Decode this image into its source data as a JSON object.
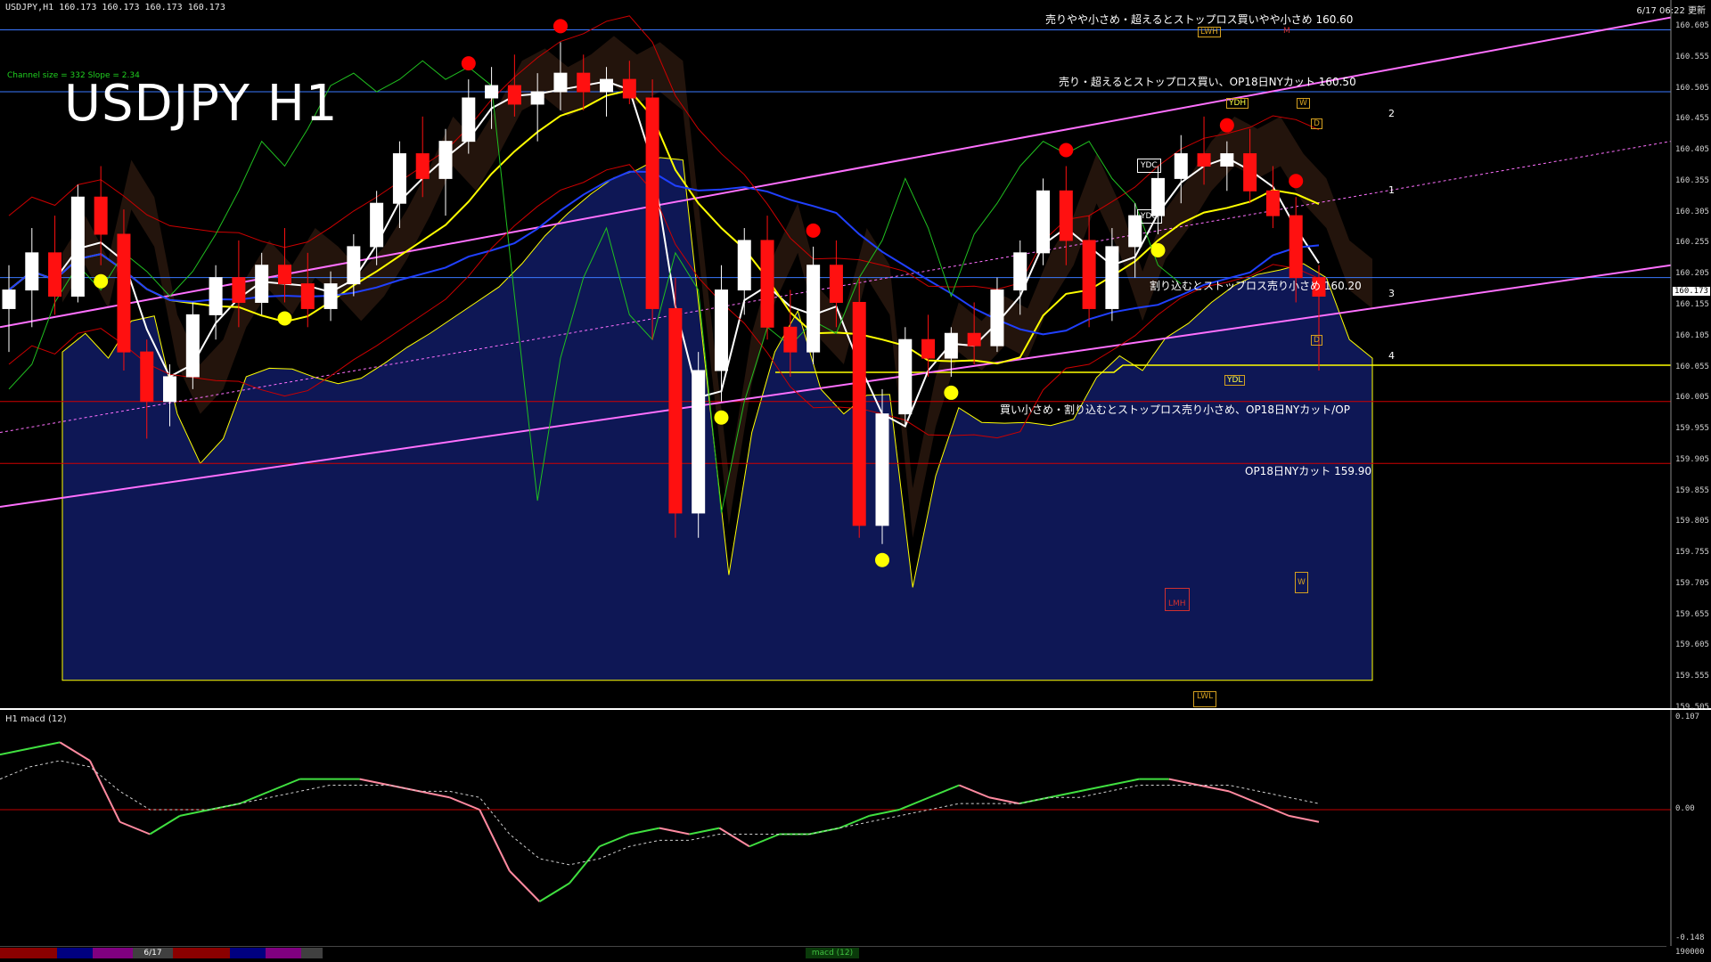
{
  "header": {
    "symbol_line": "USDJPY,H1  160.173 160.173 160.173 160.173",
    "title": "USDJPY H1",
    "channel_info": "Channel size = 332 Slope = 2.34",
    "clock": "6/17 06:22 更新"
  },
  "annotations": [
    {
      "text": "売りやや小さめ・超えるとストップロス買いやや小さめ 160.60"
    },
    {
      "text": "売り・超えるとストップロス買い、OP18日NYカット 160.50"
    },
    {
      "text": "割り込むとストップロス売り小さめ 160.20"
    },
    {
      "text": "買い小さめ・割り込むとストップロス売り小さめ、OP18日NYカット/OP"
    },
    {
      "text": "OP18日NYカット 159.90"
    }
  ],
  "level_tags": [
    "LWH",
    "M",
    "YDH",
    "W",
    "D",
    "YDC",
    "YDO",
    "YDL",
    "D",
    "W",
    "LMH",
    "LWL"
  ],
  "fib_levels": [
    "1",
    "2",
    "3",
    "4"
  ],
  "price_axis": {
    "labels": [
      "160.605",
      "160.555",
      "160.505",
      "160.455",
      "160.405",
      "160.355",
      "160.305",
      "160.255",
      "160.205",
      "160.155",
      "160.105",
      "160.055",
      "160.005",
      "159.955",
      "159.905",
      "159.855",
      "159.805",
      "159.755",
      "159.705",
      "159.655",
      "159.605",
      "159.555",
      "159.505"
    ],
    "current_price": "160.173"
  },
  "macd": {
    "label": "H1  macd (12)",
    "axis_top": "0.107",
    "axis_zero": "0.00",
    "axis_bottom": "-0.148",
    "axis_volume": "190000"
  },
  "bottom_tabs": {
    "date_tab": "6/17",
    "macd_tab": "macd (12)"
  },
  "colors": {
    "bull_candle": "#ffffff",
    "bear_candle": "#ff1010",
    "ma_short": "#ffffff",
    "ma_mid": "#ffff00",
    "ma_long": "#2040ff",
    "channel": "#ff70ff",
    "bollinger": "#cc0000",
    "chikou": "#20c020",
    "cloud_bull": "#1a2a9a",
    "cloud_bear": "#c07040",
    "support": "#ffff00",
    "macd_up": "#40e040",
    "macd_down": "#ff8aa0"
  },
  "chart_data": {
    "type": "candlestick",
    "title": "USDJPY H1",
    "timeframe": "H1",
    "date_marker": "6/17",
    "y_range": [
      159.505,
      160.605
    ],
    "horizontal_levels": [
      160.6,
      160.5,
      160.2,
      160.0,
      159.9
    ],
    "candles": [
      [
        160.15,
        160.22,
        160.08,
        160.18
      ],
      [
        160.18,
        160.28,
        160.12,
        160.24
      ],
      [
        160.24,
        160.3,
        160.14,
        160.17
      ],
      [
        160.17,
        160.35,
        160.16,
        160.33
      ],
      [
        160.33,
        160.38,
        160.22,
        160.27
      ],
      [
        160.27,
        160.31,
        160.05,
        160.08
      ],
      [
        160.08,
        160.1,
        159.94,
        160.0
      ],
      [
        160.0,
        160.06,
        159.96,
        160.04
      ],
      [
        160.04,
        160.16,
        160.02,
        160.14
      ],
      [
        160.14,
        160.22,
        160.1,
        160.2
      ],
      [
        160.2,
        160.26,
        160.12,
        160.16
      ],
      [
        160.16,
        160.24,
        160.14,
        160.22
      ],
      [
        160.22,
        160.28,
        160.16,
        160.19
      ],
      [
        160.19,
        160.24,
        160.12,
        160.15
      ],
      [
        160.15,
        160.21,
        160.13,
        160.19
      ],
      [
        160.19,
        160.27,
        160.17,
        160.25
      ],
      [
        160.25,
        160.34,
        160.22,
        160.32
      ],
      [
        160.32,
        160.42,
        160.28,
        160.4
      ],
      [
        160.4,
        160.46,
        160.33,
        160.36
      ],
      [
        160.36,
        160.44,
        160.3,
        160.42
      ],
      [
        160.42,
        160.52,
        160.4,
        160.49
      ],
      [
        160.49,
        160.54,
        160.44,
        160.51
      ],
      [
        160.51,
        160.56,
        160.46,
        160.48
      ],
      [
        160.48,
        160.53,
        160.42,
        160.5
      ],
      [
        160.5,
        160.58,
        160.47,
        160.53
      ],
      [
        160.53,
        160.56,
        160.47,
        160.5
      ],
      [
        160.5,
        160.54,
        160.46,
        160.52
      ],
      [
        160.52,
        160.55,
        160.48,
        160.49
      ],
      [
        160.49,
        160.52,
        160.1,
        160.15
      ],
      [
        160.15,
        160.2,
        159.78,
        159.82
      ],
      [
        159.82,
        160.08,
        159.78,
        160.05
      ],
      [
        160.05,
        160.22,
        160.0,
        160.18
      ],
      [
        160.18,
        160.28,
        160.14,
        160.26
      ],
      [
        160.26,
        160.3,
        160.1,
        160.12
      ],
      [
        160.12,
        160.18,
        160.04,
        160.08
      ],
      [
        160.08,
        160.25,
        160.06,
        160.22
      ],
      [
        160.22,
        160.26,
        160.12,
        160.16
      ],
      [
        160.16,
        160.2,
        159.78,
        159.8
      ],
      [
        159.8,
        160.02,
        159.77,
        159.98
      ],
      [
        159.98,
        160.12,
        159.96,
        160.1
      ],
      [
        160.1,
        160.14,
        160.04,
        160.07
      ],
      [
        160.07,
        160.12,
        160.04,
        160.11
      ],
      [
        160.11,
        160.16,
        160.06,
        160.09
      ],
      [
        160.09,
        160.2,
        160.08,
        160.18
      ],
      [
        160.18,
        160.26,
        160.14,
        160.24
      ],
      [
        160.24,
        160.36,
        160.22,
        160.34
      ],
      [
        160.34,
        160.38,
        160.22,
        160.26
      ],
      [
        160.26,
        160.3,
        160.12,
        160.15
      ],
      [
        160.15,
        160.28,
        160.13,
        160.25
      ],
      [
        160.25,
        160.32,
        160.2,
        160.3
      ],
      [
        160.3,
        160.38,
        160.27,
        160.36
      ],
      [
        160.36,
        160.43,
        160.32,
        160.4
      ],
      [
        160.4,
        160.46,
        160.35,
        160.38
      ],
      [
        160.38,
        160.42,
        160.34,
        160.4
      ],
      [
        160.4,
        160.44,
        160.32,
        160.34
      ],
      [
        160.34,
        160.38,
        160.28,
        160.3
      ],
      [
        160.3,
        160.33,
        160.16,
        160.2
      ],
      [
        160.2,
        160.22,
        160.05,
        160.17
      ]
    ],
    "macd": {
      "main": [
        0.09,
        0.1,
        0.11,
        0.08,
        -0.02,
        -0.04,
        -0.01,
        0.0,
        0.01,
        0.03,
        0.05,
        0.05,
        0.05,
        0.04,
        0.03,
        0.02,
        0.0,
        -0.1,
        -0.15,
        -0.12,
        -0.06,
        -0.04,
        -0.03,
        -0.04,
        -0.03,
        -0.06,
        -0.04,
        -0.04,
        -0.03,
        -0.01,
        0.0,
        0.02,
        0.04,
        0.02,
        0.01,
        0.02,
        0.03,
        0.04,
        0.05,
        0.05,
        0.04,
        0.03,
        0.01,
        -0.01,
        -0.02
      ],
      "signal": [
        0.05,
        0.07,
        0.08,
        0.07,
        0.03,
        0.0,
        0.0,
        0.0,
        0.01,
        0.02,
        0.03,
        0.04,
        0.04,
        0.04,
        0.03,
        0.03,
        0.02,
        -0.04,
        -0.08,
        -0.09,
        -0.08,
        -0.06,
        -0.05,
        -0.05,
        -0.04,
        -0.04,
        -0.04,
        -0.04,
        -0.03,
        -0.02,
        -0.01,
        0.0,
        0.01,
        0.01,
        0.01,
        0.02,
        0.02,
        0.03,
        0.04,
        0.04,
        0.04,
        0.04,
        0.03,
        0.02,
        0.01
      ]
    }
  }
}
